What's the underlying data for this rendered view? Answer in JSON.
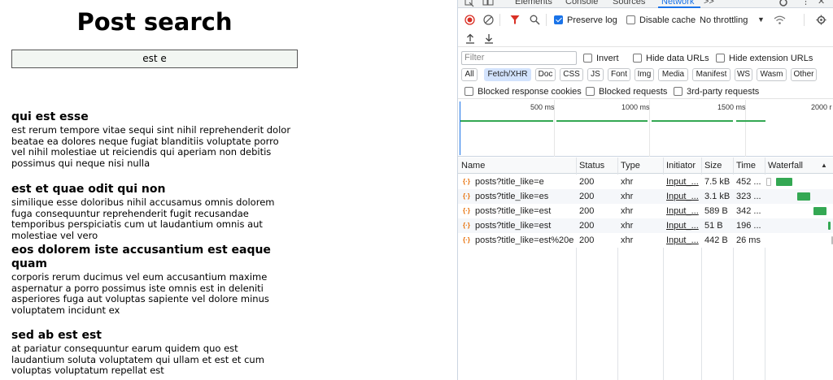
{
  "app": {
    "title": "Post search",
    "search_value": "est e",
    "posts": [
      {
        "title": "qui est esse",
        "body": "est rerum tempore vitae sequi sint nihil reprehenderit dolor beatae ea dolores neque fugiat blanditiis voluptate porro vel nihil molestiae ut reiciendis qui aperiam non debitis possimus qui neque nisi nulla"
      },
      {
        "title": "est et quae odit qui non",
        "body": "similique esse doloribus nihil accusamus omnis dolorem fuga consequuntur reprehenderit fugit recusandae temporibus perspiciatis cum ut laudantium omnis aut molestiae vel vero"
      },
      {
        "title": "eos dolorem iste accusantium est eaque quam",
        "body": "corporis rerum ducimus vel eum accusantium maxime aspernatur a porro possimus iste omnis est in deleniti asperiores fuga aut voluptas sapiente vel dolore minus voluptatem incidunt ex"
      },
      {
        "title": "sed ab est est",
        "body": "at pariatur consequuntur earum quidem quo est laudantium soluta voluptatem qui ullam et est et cum voluptas voluptatum repellat est"
      }
    ]
  },
  "devtools": {
    "tabs": [
      "Elements",
      "Console",
      "Sources",
      "Network",
      ">>"
    ],
    "active_tab": "Network",
    "toolbar": {
      "preserve_log": "Preserve log",
      "disable_cache": "Disable cache",
      "throttling": "No throttling"
    },
    "filter": {
      "placeholder": "Filter",
      "invert": "Invert",
      "hide_data_urls": "Hide data URLs",
      "hide_extension_urls": "Hide extension URLs"
    },
    "type_filters": [
      "All",
      "Fetch/XHR",
      "Doc",
      "CSS",
      "JS",
      "Font",
      "Img",
      "Media",
      "Manifest",
      "WS",
      "Wasm",
      "Other"
    ],
    "active_type": "Fetch/XHR",
    "blocked": {
      "blocked_response_cookies": "Blocked response cookies",
      "blocked_requests": "Blocked requests",
      "third_party": "3rd-party requests"
    },
    "overview_ticks": [
      "500 ms",
      "1000 ms",
      "1500 ms",
      "2000 r"
    ],
    "columns": [
      "Name",
      "Status",
      "Type",
      "Initiator",
      "Size",
      "Time",
      "Waterfall"
    ],
    "requests": [
      {
        "name": "posts?title_like=e",
        "status": "200",
        "type": "xhr",
        "initiator": "Input_...",
        "size": "7.5 kB",
        "time": "452 ..."
      },
      {
        "name": "posts?title_like=es",
        "status": "200",
        "type": "xhr",
        "initiator": "Input_...",
        "size": "3.1 kB",
        "time": "323 ..."
      },
      {
        "name": "posts?title_like=est",
        "status": "200",
        "type": "xhr",
        "initiator": "Input_...",
        "size": "589 B",
        "time": "342 ..."
      },
      {
        "name": "posts?title_like=est",
        "status": "200",
        "type": "xhr",
        "initiator": "Input_...",
        "size": "51 B",
        "time": "196 ..."
      },
      {
        "name": "posts?title_like=est%20e",
        "status": "200",
        "type": "xhr",
        "initiator": "Input_...",
        "size": "442 B",
        "time": "26 ms"
      }
    ],
    "colors": {
      "accent": "#1a73e8",
      "waterfall": "#34a853",
      "record": "#d93025"
    }
  }
}
